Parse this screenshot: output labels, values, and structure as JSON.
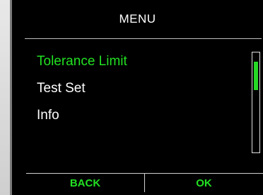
{
  "header": {
    "title": "MENU"
  },
  "menu": {
    "items": [
      {
        "label": "Tolerance Limit",
        "selected": true
      },
      {
        "label": "Test Set",
        "selected": false
      },
      {
        "label": "Info",
        "selected": false
      }
    ]
  },
  "softkeys": {
    "left_label": "BACK",
    "right_label": "OK"
  },
  "colors": {
    "background": "#000000",
    "accent": "#22e022",
    "text": "#ffffff"
  }
}
